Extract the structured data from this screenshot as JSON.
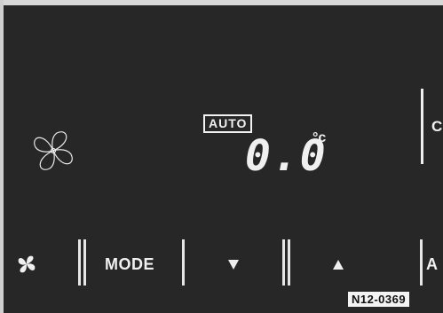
{
  "display": {
    "mode_indicator": "AUTO",
    "temperature": "0.0",
    "unit": "°c",
    "right_partial_label": "C"
  },
  "controls": {
    "fan_button_icon": "fan-icon",
    "mode_label": "MODE",
    "temp_down_icon": "down-triangle-icon",
    "temp_up_icon": "up-triangle-icon",
    "right_partial_label": "A"
  },
  "figure_code": "N12-0369",
  "colors": {
    "background": "#272727",
    "foreground": "#f0f0f0"
  }
}
